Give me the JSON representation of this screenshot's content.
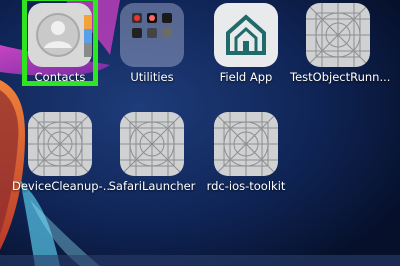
{
  "home_screen": {
    "apps": [
      {
        "id": "contacts",
        "label": "Contacts",
        "icon": "contacts-icon"
      },
      {
        "id": "utilities",
        "label": "Utilities",
        "icon": "folder-icon"
      },
      {
        "id": "field-app",
        "label": "Field App",
        "icon": "house-icon"
      },
      {
        "id": "test-object-runner",
        "label": "TestObjectRunn...",
        "icon": "placeholder-icon"
      },
      {
        "id": "device-cleanup",
        "label": "DeviceCleanup-...",
        "icon": "placeholder-icon"
      },
      {
        "id": "safari-launcher",
        "label": "SafariLauncher",
        "icon": "placeholder-icon"
      },
      {
        "id": "rdc-ios-toolkit",
        "label": "rdc-ios-toolkit",
        "icon": "placeholder-icon"
      }
    ],
    "highlight_color": "#2fe51f"
  }
}
